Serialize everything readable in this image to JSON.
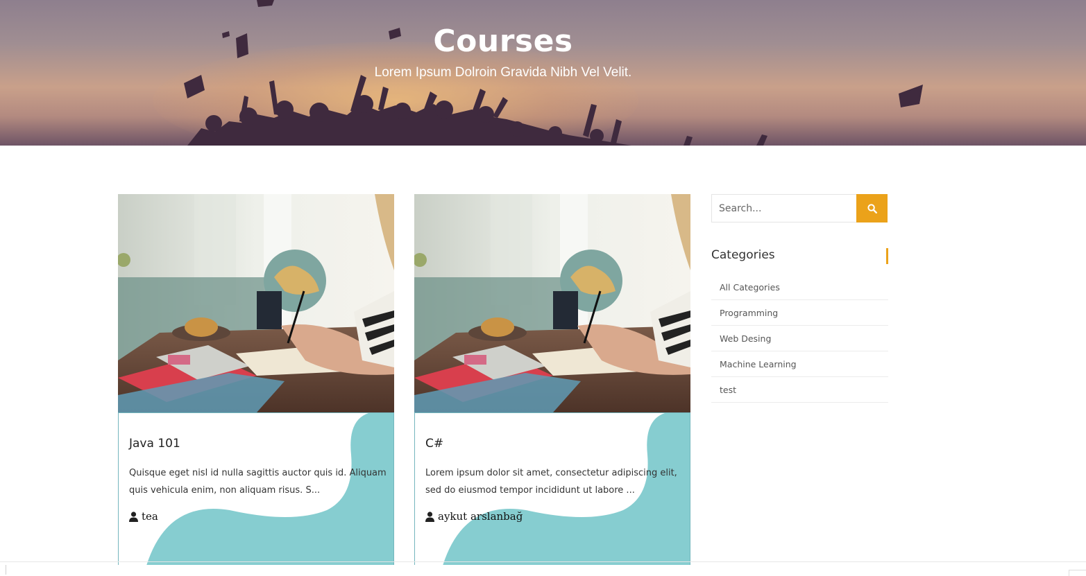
{
  "hero": {
    "title": "Courses",
    "subtitle": "Lorem Ipsum Dolroin Gravida Nibh Vel Velit."
  },
  "courses": [
    {
      "title": "Java 101",
      "description": "Quisque eget nisl id nulla sagittis auctor quis id. Aliquam quis vehicula enim, non aliquam risus. S...",
      "author": "tea",
      "author_icon": "user-icon",
      "image_icon": "course-photo"
    },
    {
      "title": "C#",
      "description": "Lorem ipsum dolor sit amet, consectetur adipiscing elit, sed do eiusmod tempor incididunt ut labore ...",
      "author": "aykut arslanbağ",
      "author_icon": "user-icon",
      "image_icon": "course-photo"
    }
  ],
  "sidebar": {
    "search": {
      "placeholder": "Search...",
      "button_icon": "search-icon"
    },
    "categories": {
      "heading": "Categories",
      "items": [
        {
          "label": "All Categories"
        },
        {
          "label": "Programming"
        },
        {
          "label": "Web Desing"
        },
        {
          "label": "Machine Learning"
        },
        {
          "label": "test"
        }
      ]
    }
  },
  "colors": {
    "accent": "#eba21a",
    "card_border": "#74b6bd",
    "wave": "#86cdd0"
  }
}
